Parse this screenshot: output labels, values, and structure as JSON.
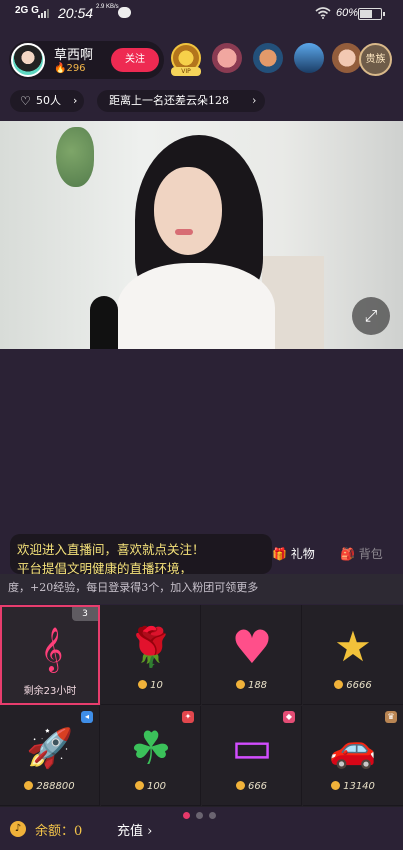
{
  "status_bar": {
    "network": "2G",
    "network2": "G",
    "time": "20:54",
    "speed": "2.9 KB/s",
    "battery": "60%"
  },
  "host": {
    "name": "草西啊",
    "fans": "296",
    "follow_label": "关注"
  },
  "noble_label": "贵族",
  "vip_label": "VIP",
  "likes": {
    "count": "50人",
    "chevron": "›"
  },
  "rank": {
    "text": "距离上一名还差云朵128",
    "chevron": "›"
  },
  "chat": {
    "line1": "欢迎进入直播间，喜欢就点关注！",
    "line2": "平台提倡文明健康的直播环境，"
  },
  "tabs": {
    "gift": "礼物",
    "bag": "背包"
  },
  "notice": "度，+20经验，每日登录得3个，加入粉团可领更多",
  "gifts": [
    {
      "name": "treble-clef-gift",
      "icon": "𝄞",
      "price": "剩余23小时",
      "count": "3",
      "color": "#ff3f7a"
    },
    {
      "name": "rose-gift",
      "icon": "🌹",
      "price": "10",
      "color": "#e0202a"
    },
    {
      "name": "heart-gift",
      "icon": "♥",
      "price": "188",
      "color": "#ff4f8a"
    },
    {
      "name": "super-star-gift",
      "icon": "★",
      "price": "6666",
      "color": "#f2c23a"
    },
    {
      "name": "rocket-gift",
      "icon": "🚀",
      "price": "288800",
      "color": "#f19a2e"
    },
    {
      "name": "clover-gift",
      "icon": "☘",
      "price": "100",
      "color": "#3bc15a"
    },
    {
      "name": "sign-gift",
      "icon": "▭",
      "price": "666",
      "color": "#d24dff"
    },
    {
      "name": "car-gift",
      "icon": "🚗",
      "price": "13140",
      "color": "#35c2c9"
    }
  ],
  "balance": {
    "label": "余额：0",
    "recharge": "充值",
    "chevron": "›"
  }
}
